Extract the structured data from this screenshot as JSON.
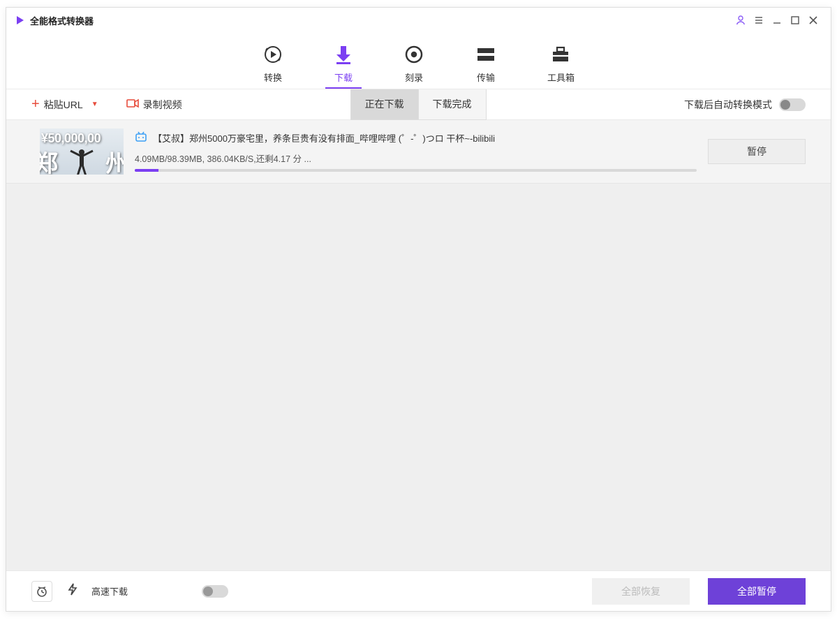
{
  "app": {
    "title": "全能格式转换器"
  },
  "maintabs": {
    "convert": "转换",
    "download": "下载",
    "burn": "刻录",
    "transfer": "传输",
    "toolbox": "工具箱"
  },
  "actions": {
    "paste_url": "粘贴URL",
    "record_video": "录制视频"
  },
  "segtabs": {
    "downloading": "正在下载",
    "done": "下载完成"
  },
  "right": {
    "auto_convert_label": "下载后自动转换模式"
  },
  "item": {
    "thumb_price": "¥50,000,00",
    "thumb_char1": "郑",
    "thumb_char2": "州",
    "title": "【艾叔】郑州5000万豪宅里，养条巨贵有没有排面_哔哩哔哩 (゜-゜)つロ 干杯~-bilibili",
    "status": "4.09MB/98.39MB, 386.04KB/S,还剩4.17 分 ...",
    "progress_pct": 4.2,
    "pause_label": "暂停"
  },
  "footer": {
    "fast_download": "高速下载",
    "resume_all": "全部恢复",
    "pause_all": "全部暂停"
  }
}
